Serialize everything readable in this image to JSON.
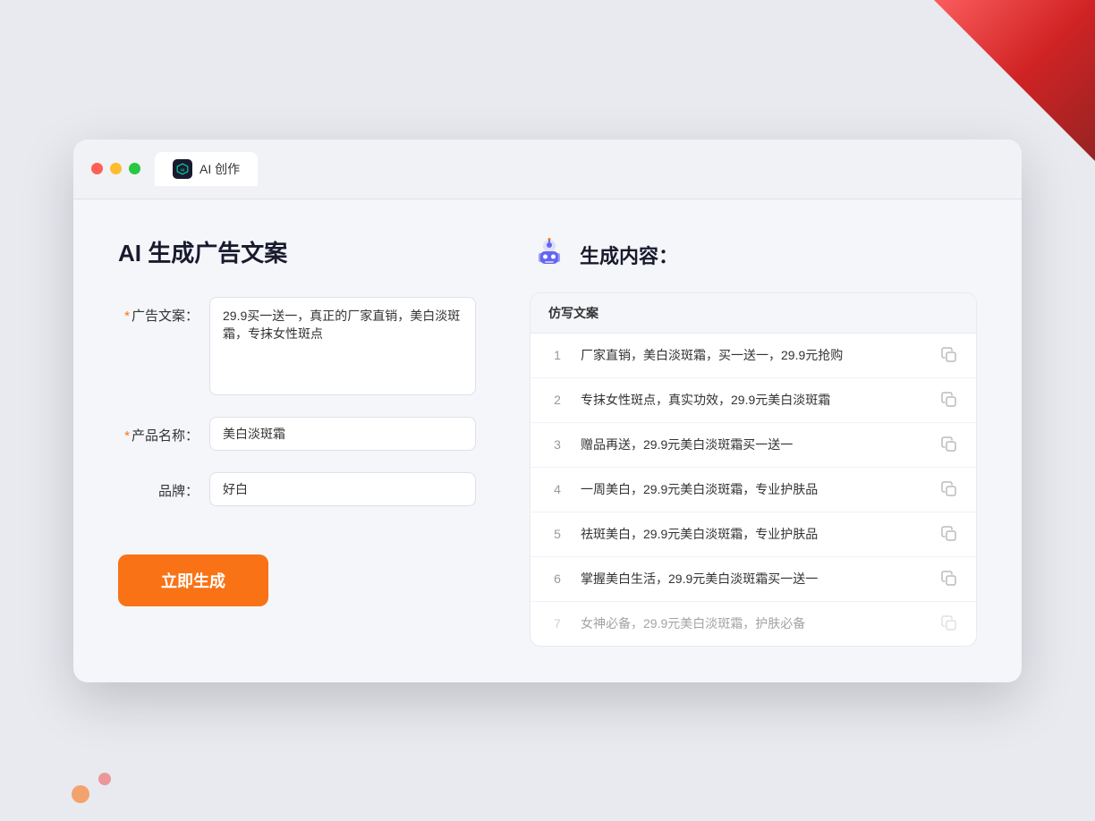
{
  "browser": {
    "tab_label": "AI 创作"
  },
  "page": {
    "title": "AI 生成广告文案",
    "right_title": "生成内容："
  },
  "form": {
    "ad_copy_label": "广告文案：",
    "ad_copy_required": "*",
    "ad_copy_value": "29.9买一送一，真正的厂家直销，美白淡斑霜，专抹女性斑点",
    "product_name_label": "产品名称：",
    "product_name_required": "*",
    "product_name_value": "美白淡斑霜",
    "brand_label": "品牌：",
    "brand_value": "好白",
    "generate_btn_label": "立即生成"
  },
  "results": {
    "column_header": "仿写文案",
    "items": [
      {
        "num": "1",
        "text": "厂家直销，美白淡斑霜，买一送一，29.9元抢购",
        "dimmed": false
      },
      {
        "num": "2",
        "text": "专抹女性斑点，真实功效，29.9元美白淡斑霜",
        "dimmed": false
      },
      {
        "num": "3",
        "text": "赠品再送，29.9元美白淡斑霜买一送一",
        "dimmed": false
      },
      {
        "num": "4",
        "text": "一周美白，29.9元美白淡斑霜，专业护肤品",
        "dimmed": false
      },
      {
        "num": "5",
        "text": "祛斑美白，29.9元美白淡斑霜，专业护肤品",
        "dimmed": false
      },
      {
        "num": "6",
        "text": "掌握美白生活，29.9元美白淡斑霜买一送一",
        "dimmed": false
      },
      {
        "num": "7",
        "text": "女神必备，29.9元美白淡斑霜，护肤必备",
        "dimmed": true
      }
    ]
  }
}
